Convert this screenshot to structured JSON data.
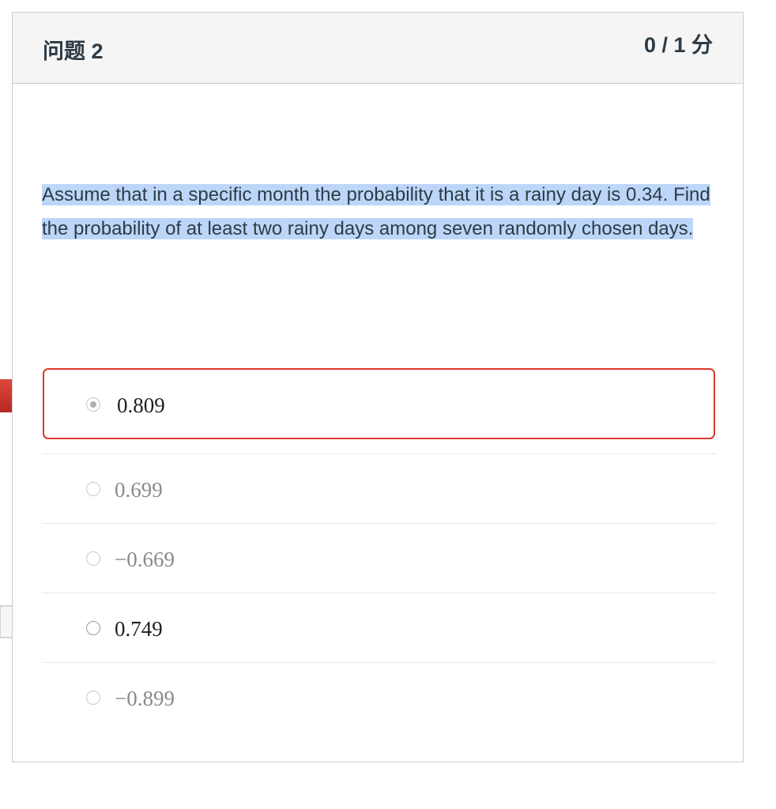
{
  "header": {
    "title": "问题 2",
    "points": "0 / 1 分"
  },
  "question": {
    "text": "Assume that in a specific month the probability that it is a rainy day is 0.34. Find the probability of at least two rainy days among seven randomly chosen days."
  },
  "answers": [
    {
      "label": "0.809",
      "selected": true,
      "marker": "incorrect"
    },
    {
      "label": "0.699",
      "selected": false
    },
    {
      "label": "−0.669",
      "selected": false
    },
    {
      "label": "0.749",
      "selected": false,
      "marker": "correct"
    },
    {
      "label": "−0.899",
      "selected": false
    }
  ],
  "colors": {
    "incorrect_marker": "#c9302c",
    "selected_border": "#e0392d",
    "highlight": "#bcd6f9"
  }
}
